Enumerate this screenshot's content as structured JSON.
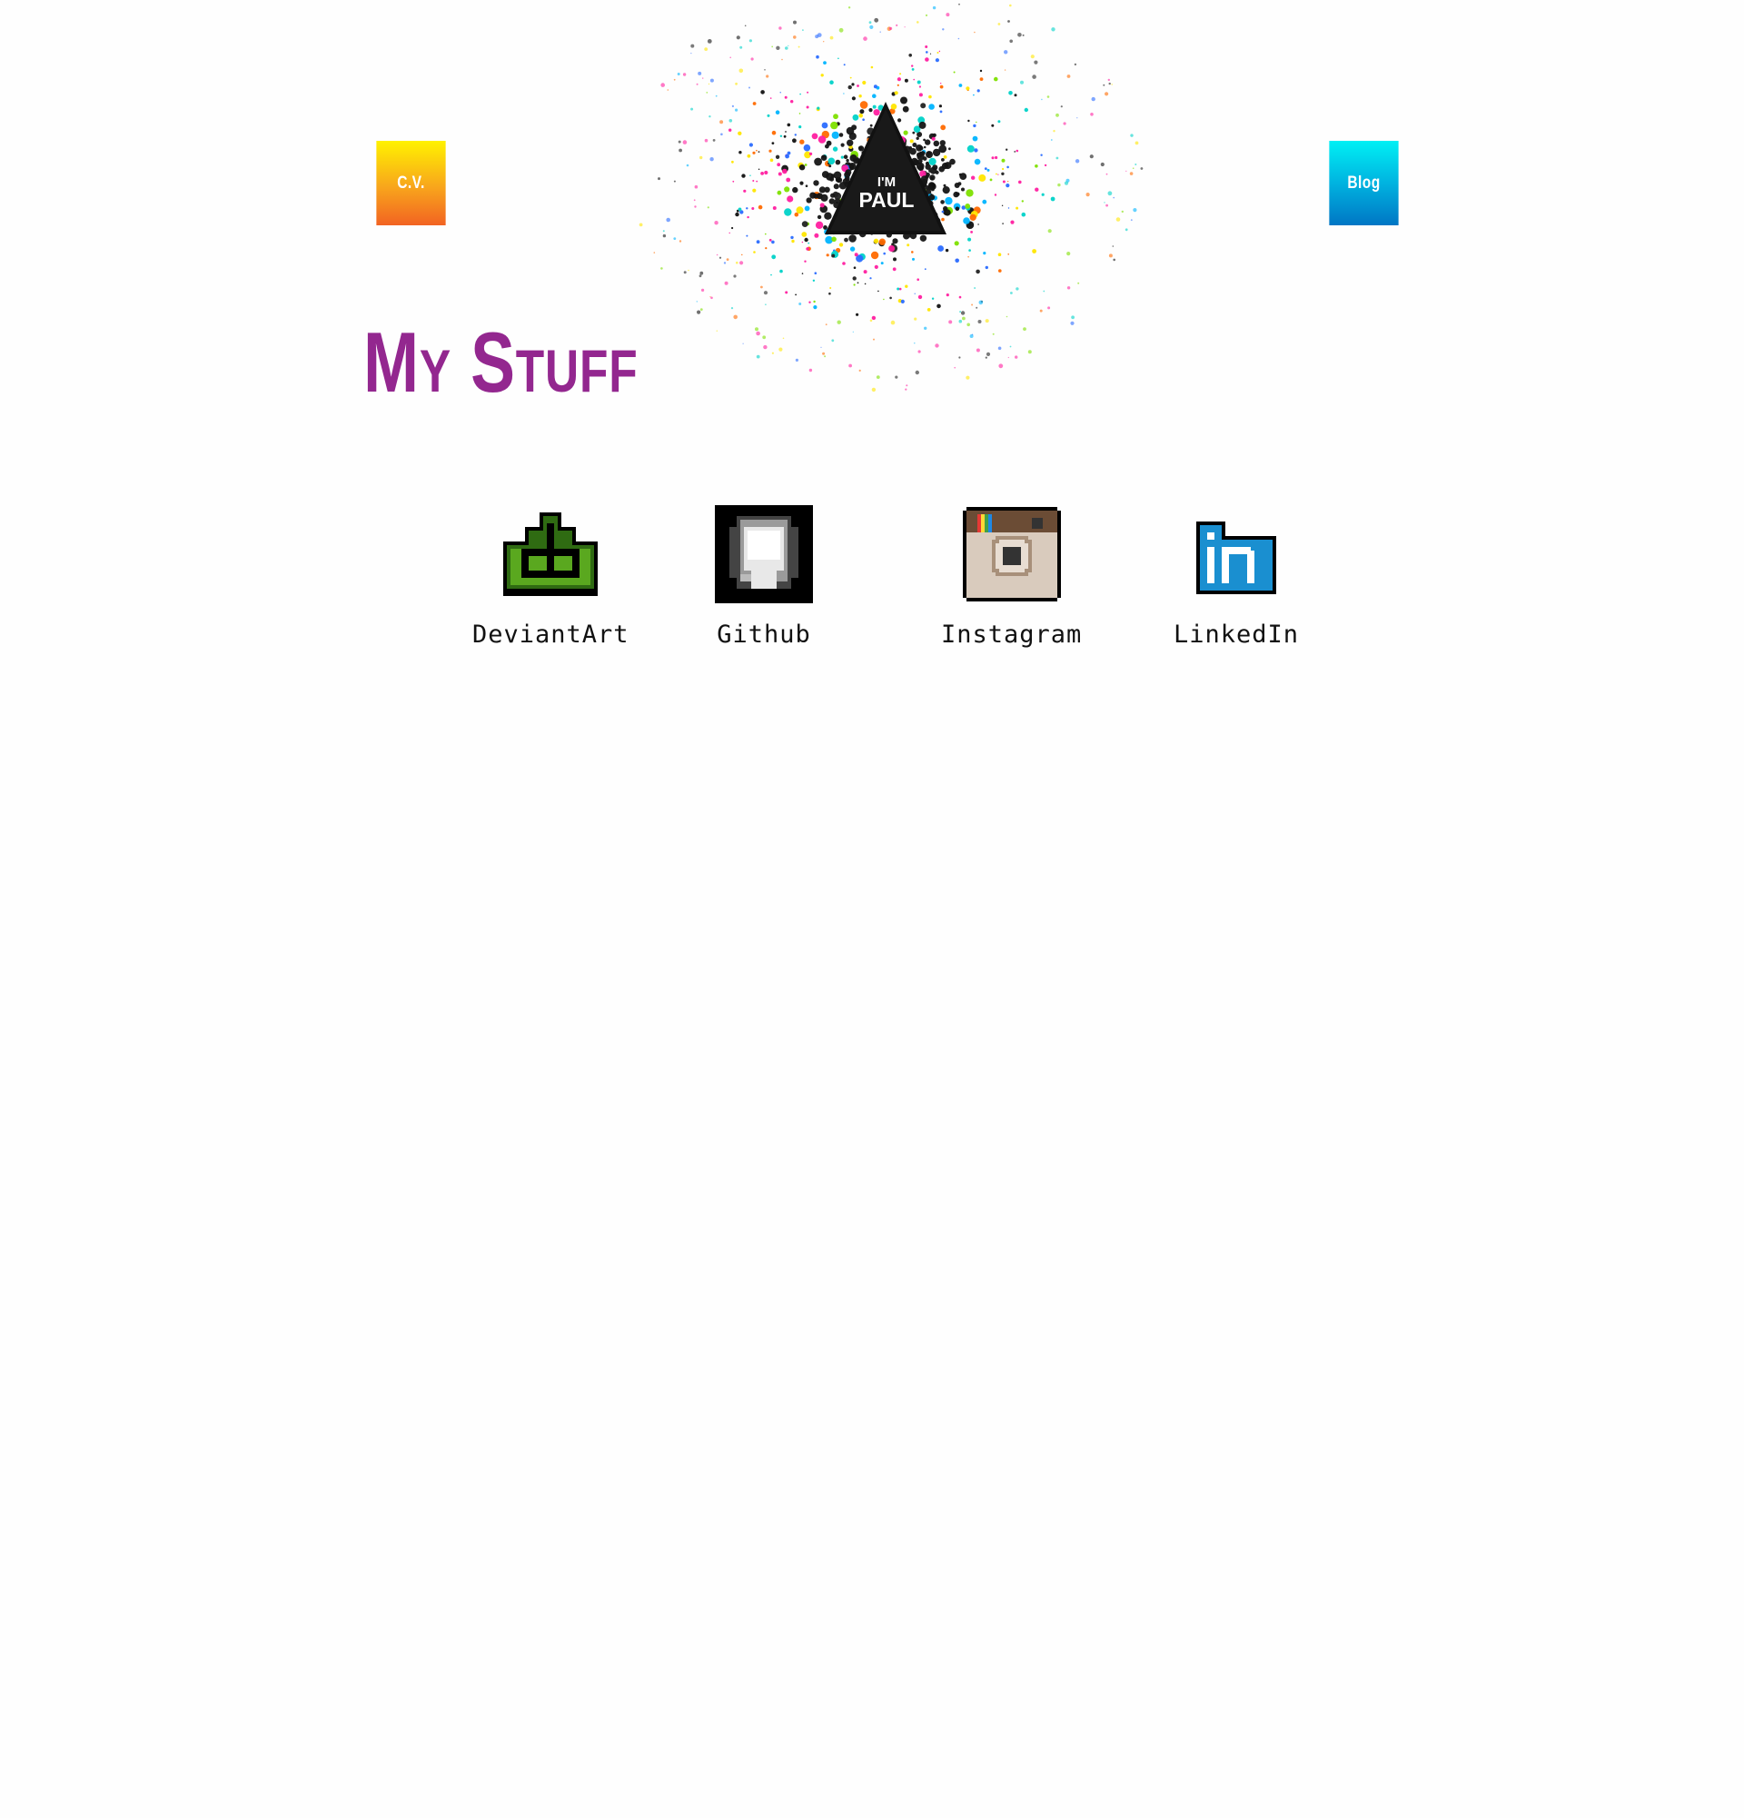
{
  "header": {
    "cv_label": "C.V.",
    "blog_label": "Blog",
    "logo_line1": "I'M",
    "logo_line2": "PAUL"
  },
  "main": {
    "title": "My Stuff",
    "links": [
      {
        "label": "DeviantArt",
        "icon": "deviantart-icon"
      },
      {
        "label": "Github",
        "icon": "github-icon"
      },
      {
        "label": "Instagram",
        "icon": "instagram-icon"
      },
      {
        "label": "LinkedIn",
        "icon": "linkedin-icon"
      }
    ]
  },
  "colors": {
    "title": "#93278f",
    "cv_gradient": [
      "#fff200",
      "#f26322"
    ],
    "blog_gradient": [
      "#00f0f4",
      "#0076c4"
    ],
    "deviantart_green": "#4a9a1c",
    "linkedin_blue": "#1a8fd0"
  }
}
